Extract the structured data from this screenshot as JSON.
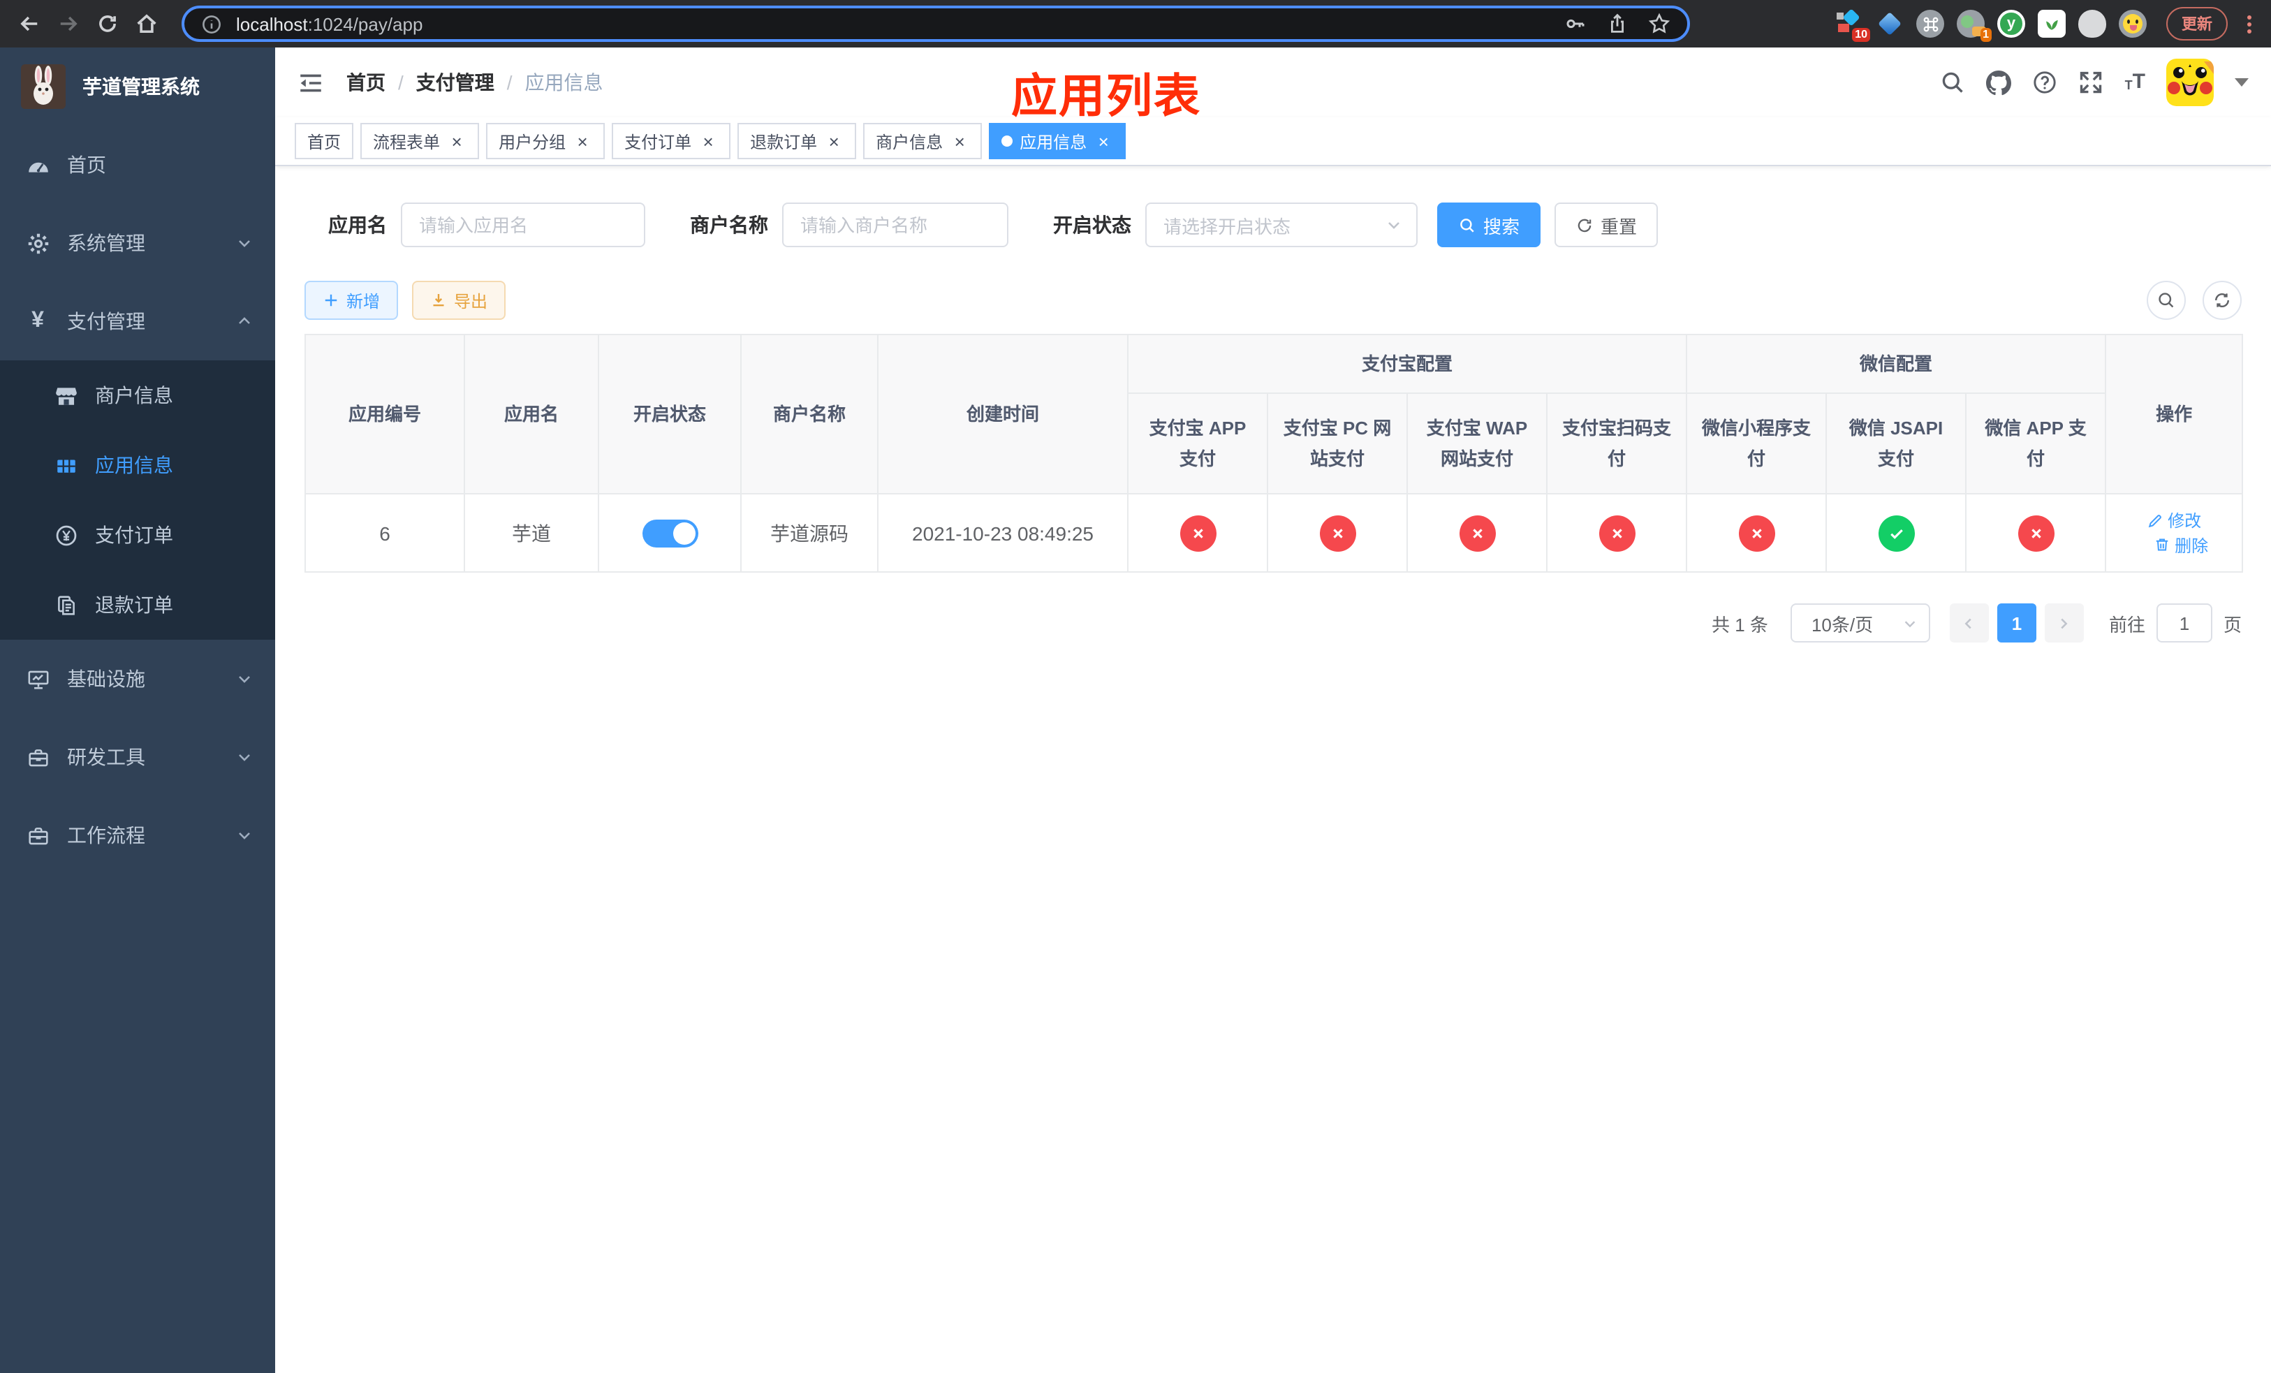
{
  "browser": {
    "url_host": "localhost",
    "url_rest": ":1024/pay/app",
    "update_label": "更新",
    "extensions": [
      {
        "name": "blocks",
        "badge": "10"
      },
      {
        "name": "gem"
      },
      {
        "name": "command"
      },
      {
        "name": "session",
        "badge": "1"
      },
      {
        "name": "y-circle"
      },
      {
        "name": "leaf"
      },
      {
        "name": "silhouette"
      },
      {
        "name": "emoji"
      }
    ]
  },
  "sidebar": {
    "title": "芋道管理系统",
    "items": [
      {
        "label": "首页",
        "icon": "dashboard-icon"
      },
      {
        "label": "系统管理",
        "icon": "gear-icon",
        "expandable": true
      },
      {
        "label": "支付管理",
        "icon": "yen-icon",
        "expandable": true,
        "expanded": true,
        "children": [
          {
            "label": "商户信息",
            "icon": "shop-icon"
          },
          {
            "label": "应用信息",
            "icon": "grid-icon",
            "active": true
          },
          {
            "label": "支付订单",
            "icon": "yen-circle-icon"
          },
          {
            "label": "退款订单",
            "icon": "document-icon"
          }
        ]
      },
      {
        "label": "基础设施",
        "icon": "monitor-icon",
        "expandable": true
      },
      {
        "label": "研发工具",
        "icon": "toolbox-icon",
        "expandable": true
      },
      {
        "label": "工作流程",
        "icon": "briefcase-icon",
        "expandable": true
      }
    ]
  },
  "navbar": {
    "breadcrumb": [
      "首页",
      "支付管理",
      "应用信息"
    ]
  },
  "overlay_title": "应用列表",
  "tags": [
    {
      "label": "首页",
      "closable": false
    },
    {
      "label": "流程表单",
      "closable": true
    },
    {
      "label": "用户分组",
      "closable": true
    },
    {
      "label": "支付订单",
      "closable": true
    },
    {
      "label": "退款订单",
      "closable": true
    },
    {
      "label": "商户信息",
      "closable": true
    },
    {
      "label": "应用信息",
      "closable": true,
      "active": true
    }
  ],
  "filters": {
    "app_name": {
      "label": "应用名",
      "placeholder": "请输入应用名"
    },
    "merchant": {
      "label": "商户名称",
      "placeholder": "请输入商户名称"
    },
    "status": {
      "label": "开启状态",
      "placeholder": "请选择开启状态"
    },
    "search_label": "搜索",
    "reset_label": "重置"
  },
  "toolbar": {
    "add_label": "新增",
    "export_label": "导出"
  },
  "table": {
    "columns": {
      "id": "应用编号",
      "name": "应用名",
      "enabled": "开启状态",
      "merchant": "商户名称",
      "created": "创建时间",
      "ops": "操作"
    },
    "groups": {
      "alipay": "支付宝配置",
      "wechat": "微信配置"
    },
    "sub_columns": [
      "支付宝 APP 支付",
      "支付宝 PC 网站支付",
      "支付宝 WAP 网站支付",
      "支付宝扫码支付",
      "微信小程序支付",
      "微信 JSAPI 支付",
      "微信 APP 支付"
    ],
    "row": {
      "id": "6",
      "name": "芋道",
      "enabled": true,
      "merchant": "芋道源码",
      "created": "2021-10-23 08:49:25",
      "configs": [
        false,
        false,
        false,
        false,
        false,
        true,
        false
      ],
      "edit_label": "修改",
      "delete_label": "删除"
    }
  },
  "pagination": {
    "total": "共 1 条",
    "page_size": "10条/页",
    "current": "1",
    "goto_label": "前往",
    "goto_value": "1",
    "page_unit": "页"
  },
  "colors": {
    "accent": "#409eff",
    "success": "#13ce66",
    "danger": "#f5484d",
    "warning": "#e6a23c",
    "title_red": "#ff2d08"
  }
}
